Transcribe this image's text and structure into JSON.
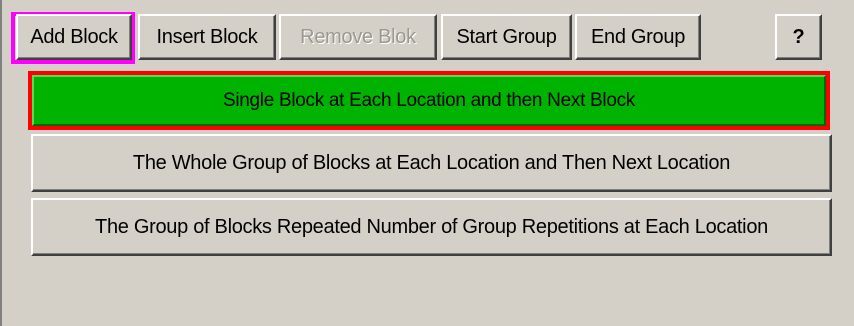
{
  "toolbar": {
    "add_block": "Add Block",
    "insert_block": "Insert Block",
    "remove_block": "Remove Blok",
    "start_group": "Start Group",
    "end_group": "End Group",
    "help": "?"
  },
  "options": [
    {
      "label": "Single Block at Each Location and then Next Block",
      "selected": true
    },
    {
      "label": "The Whole Group of Blocks at Each Location and Then Next Location",
      "selected": false
    },
    {
      "label": "The Group of Blocks Repeated Number of Group Repetitions at Each Location",
      "selected": false
    }
  ],
  "colors": {
    "panel_bg": "#d4d0c8",
    "selected_bg": "#00b300",
    "selected_border": "#ff0000",
    "focus_highlight": "#ff00ff",
    "disabled_text": "#9a9890"
  }
}
